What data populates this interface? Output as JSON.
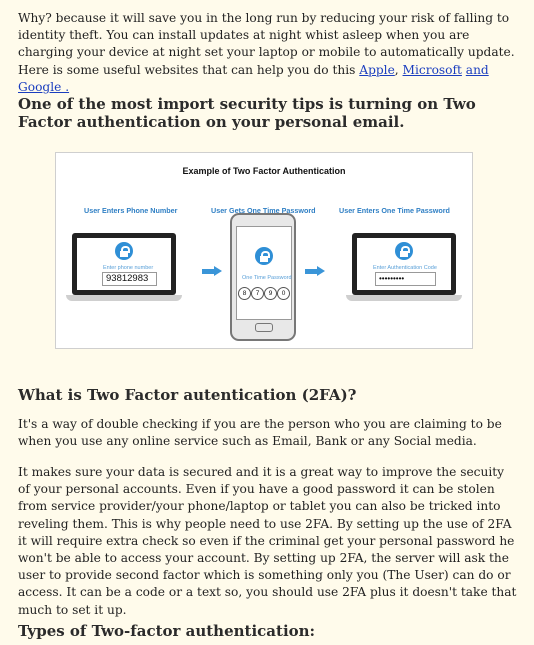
{
  "intro": {
    "text": "Why? because it will save you in the long run by reducing your risk of falling to identity theft. You can install updates at night whist asleep when you are charging your device at night set your laptop or mobile to automatically update. Here is some useful websites that can help you do this ",
    "link_apple": "Apple",
    "sep1": ", ",
    "link_microsoft": "Microsoft",
    "sep2": " ",
    "link_google": "and Google .",
    "trail": ""
  },
  "tip_heading": "One of the most import security tips is turning on Two Factor authentication on your personal email.",
  "figure": {
    "title": "Example of Two Factor Authentication",
    "steps": [
      "User Enters  Phone Number",
      "User Gets One Time Password",
      "User Enters One Time Password"
    ],
    "phone_label": "Enter phone number",
    "phone_value": "93812983",
    "otp_label": "One Time Password",
    "otp_digits": [
      "8",
      "7",
      "9",
      "0"
    ],
    "auth_label": "Enter Authentication Code",
    "auth_value": "•••••••••"
  },
  "what_heading": "What is Two Factor autentication (2FA)?",
  "what_para": "It's a way of double checking if you are the person who you are claiming to be when you use any online service such as Email, Bank or any Social media.",
  "secure_para": "It makes sure your data is secured and it is a great way to improve the secuity of your personal accounts. Even if you have a good password it can be stolen from service provider/your phone/laptop or tablet you can also be tricked into reveling them. This is why people need to use 2FA. By setting up the use of 2FA it will require extra check so even if the criminal get your personal password he won't be able to access your account. By setting up 2FA, the server will ask the user to provide second factor which is something only you (The User) can do or access. It can be a code or a text so, you should use 2FA plus it doesn't take that much to set it up.",
  "types_heading": "Types of Two-factor authentication:"
}
